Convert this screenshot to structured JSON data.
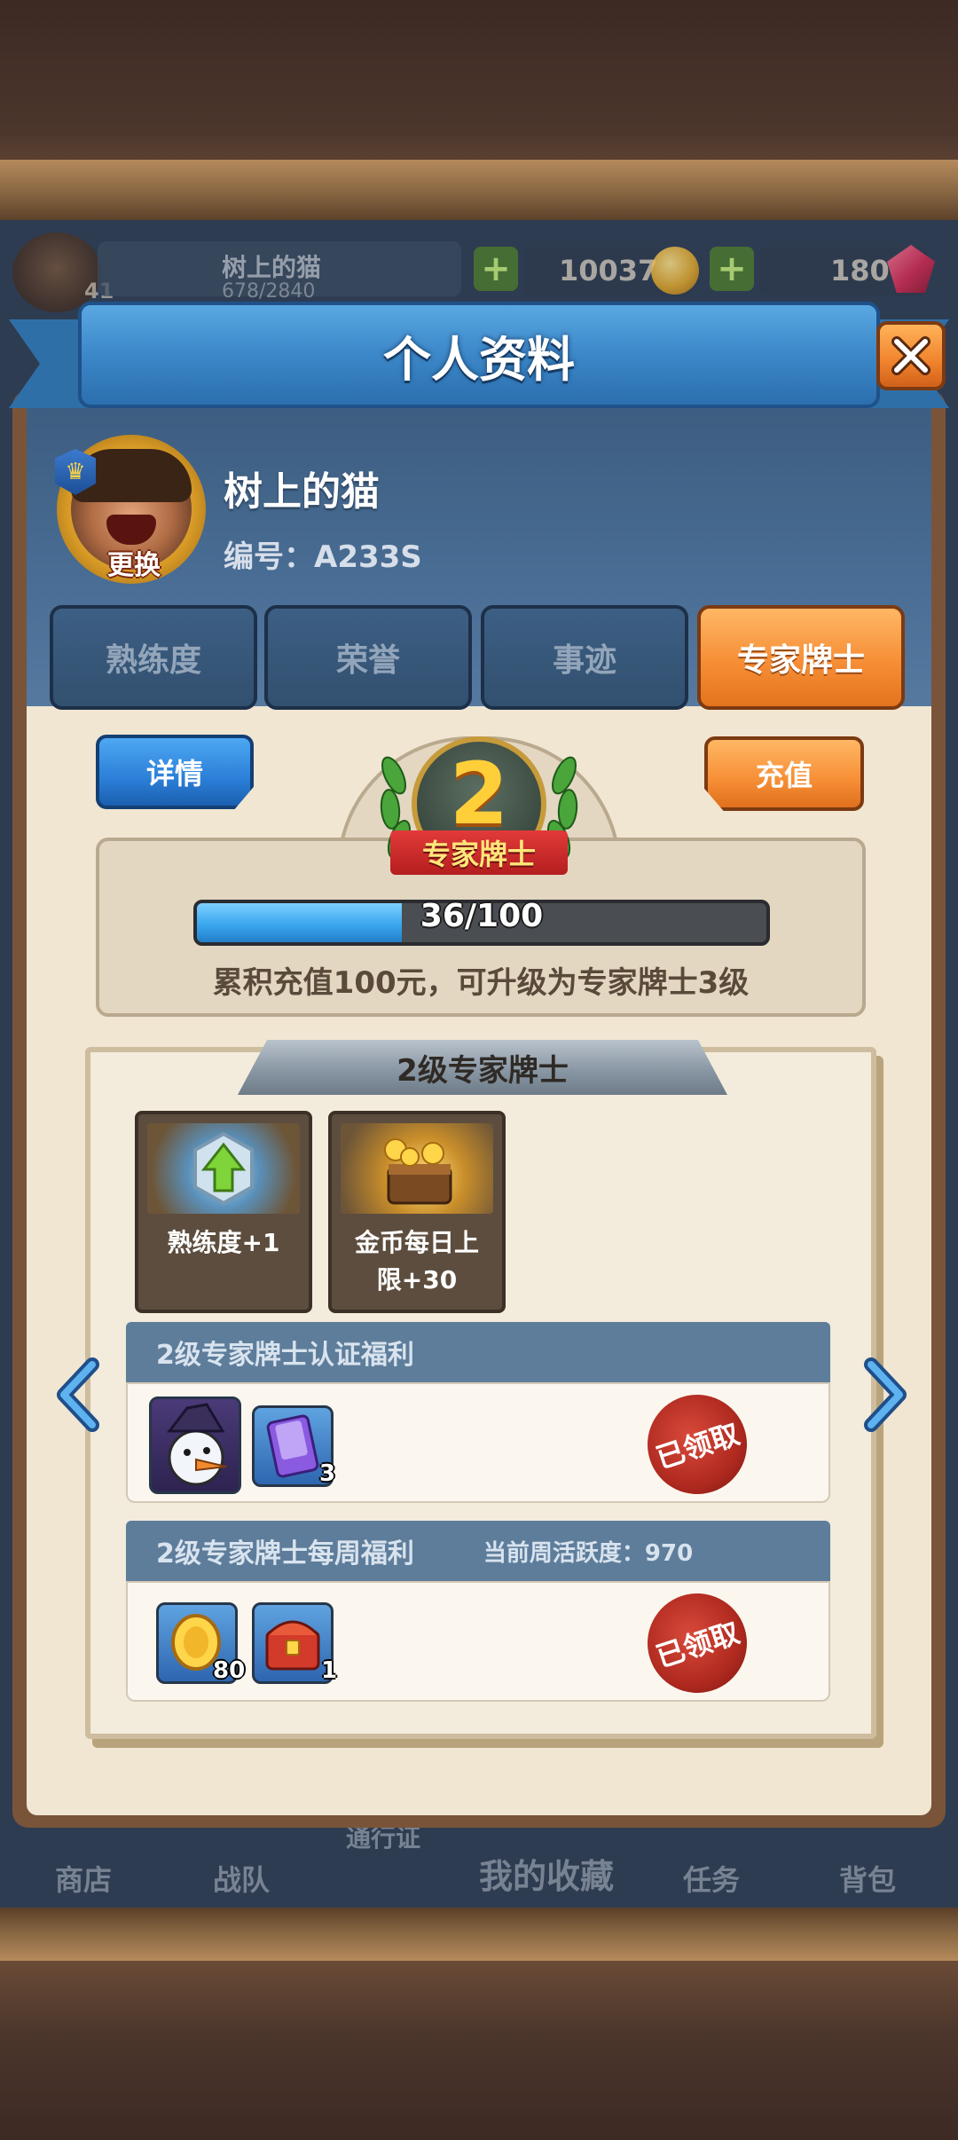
{
  "hud": {
    "player_name": "树上的猫",
    "exp": "678/2840",
    "level": "41",
    "coins": "10037",
    "gems": "180"
  },
  "modal": {
    "title": "个人资料",
    "player": {
      "name": "树上的猫",
      "id_label": "编号：",
      "id_value": "A233S",
      "change_avatar_label": "更换"
    },
    "tabs": [
      {
        "label": "熟练度",
        "active": false
      },
      {
        "label": "荣誉",
        "active": false
      },
      {
        "label": "事迹",
        "active": false
      },
      {
        "label": "专家牌士",
        "active": true
      }
    ],
    "buttons": {
      "detail": "详情",
      "recharge": "充值"
    },
    "rank": {
      "level_number": "2",
      "title": "专家牌士",
      "progress_text": "36/100",
      "progress_fraction": 0.36,
      "upgrade_hint": "累积充值100元，可升级为专家牌士3级"
    },
    "scroll": {
      "header": "2级专家牌士",
      "perks": [
        {
          "label_line1": "熟练度+1",
          "label_line2": "",
          "icon": "upgrade-arrow-icon"
        },
        {
          "label_line1": "金币每日上",
          "label_line2": "限+30",
          "icon": "treasure-chest-icon"
        }
      ],
      "certification": {
        "title": "2级专家牌士认证福利",
        "items": [
          {
            "icon": "snowman-avatar-icon",
            "count": ""
          },
          {
            "icon": "card-pack-icon",
            "count": "3"
          }
        ],
        "status": "已领取"
      },
      "weekly": {
        "title": "2级专家牌士每周福利",
        "activity_label": "当前周活跃度：",
        "activity_value": "970",
        "items": [
          {
            "icon": "gold-coin-icon",
            "count": "80"
          },
          {
            "icon": "red-chest-icon",
            "count": "1"
          }
        ],
        "status": "已领取"
      }
    }
  },
  "bottom_nav": [
    {
      "label": "商店"
    },
    {
      "label": "战队"
    },
    {
      "label": "通行证"
    },
    {
      "label": "我的收藏"
    },
    {
      "label": "任务"
    },
    {
      "label": "背包"
    }
  ],
  "colors": {
    "accent_orange": "#f68e36",
    "accent_blue": "#3e8acb",
    "progress_blue": "#3aa6ee"
  }
}
